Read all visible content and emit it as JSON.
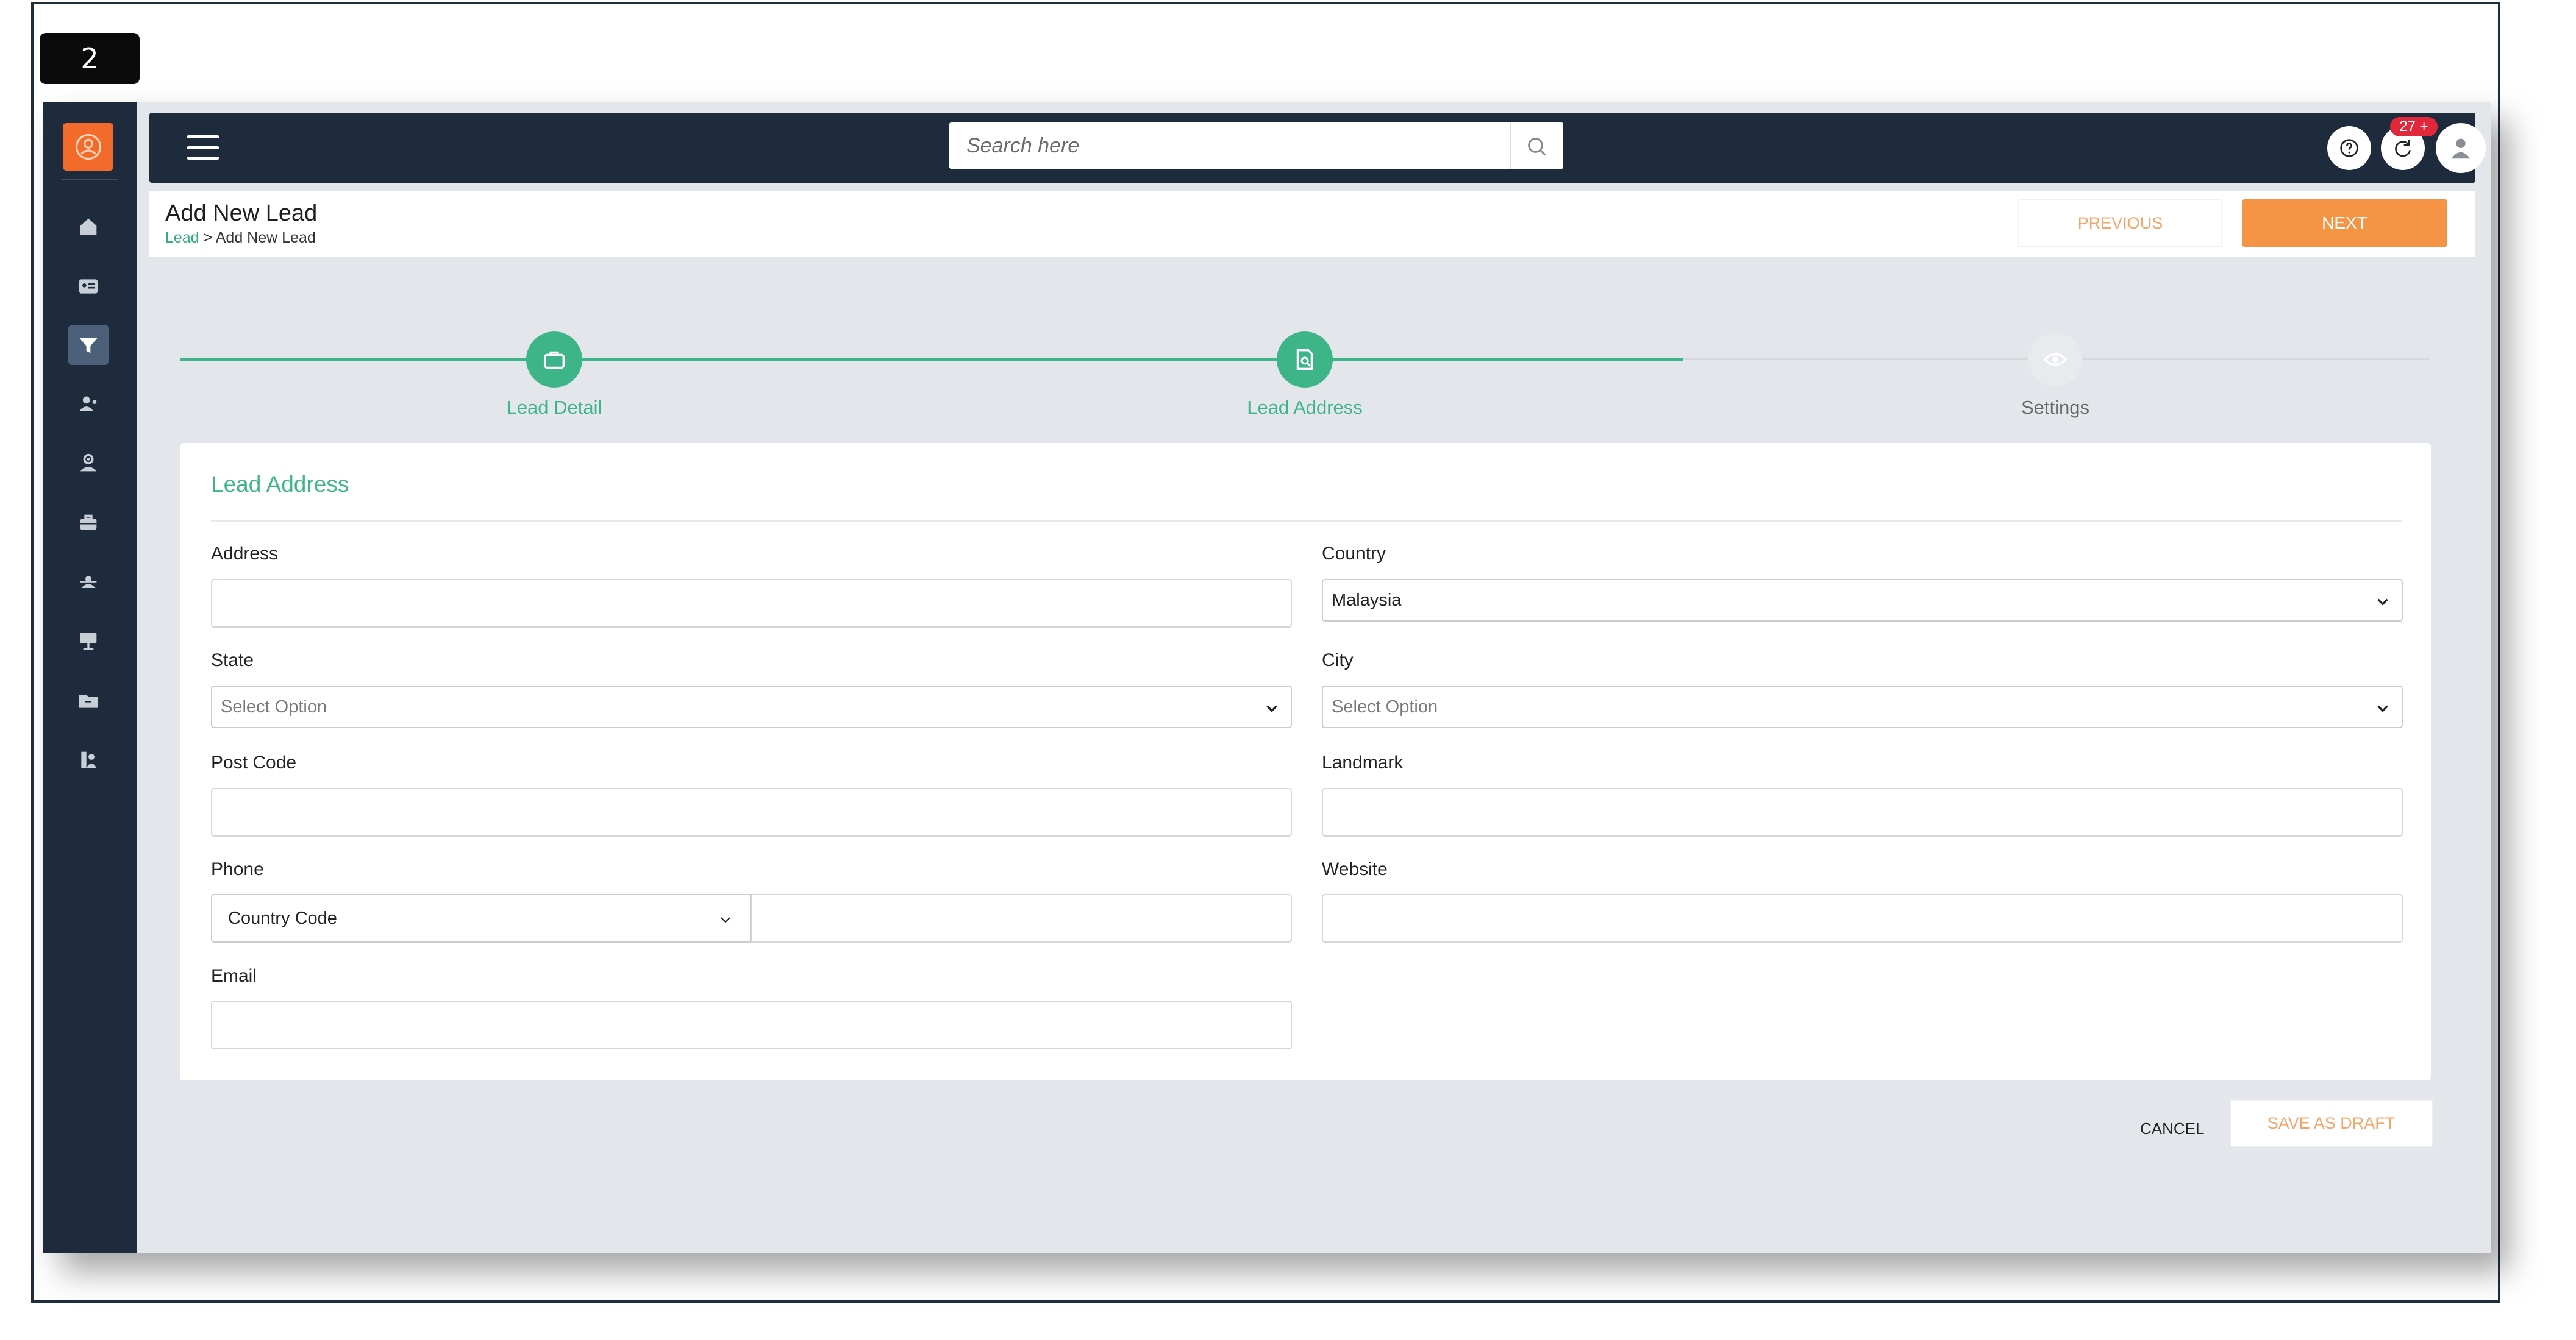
{
  "step_badge": "2",
  "header": {
    "search_placeholder": "Search here",
    "notification_count": "27 +"
  },
  "page": {
    "title": "Add New Lead",
    "breadcrumb_link": "Lead",
    "breadcrumb_separator": " > ",
    "breadcrumb_current": "Add New Lead",
    "previous_label": "PREVIOUS",
    "next_label": "NEXT"
  },
  "stepper": {
    "steps": [
      {
        "label": "Lead Detail",
        "state": "done",
        "icon": "briefcase-icon"
      },
      {
        "label": "Lead Address",
        "state": "current",
        "icon": "document-search-icon"
      },
      {
        "label": "Settings",
        "state": "todo",
        "icon": "eye-icon"
      }
    ]
  },
  "form": {
    "section_title": "Lead Address",
    "address_label": "Address",
    "address_value": "",
    "country_label": "Country",
    "country_value": "Malaysia",
    "state_label": "State",
    "state_value": "Select Option",
    "city_label": "City",
    "city_value": "Select Option",
    "postcode_label": "Post Code",
    "postcode_value": "",
    "landmark_label": "Landmark",
    "landmark_value": "",
    "phone_label": "Phone",
    "country_code_value": "Country Code",
    "phone_value": "",
    "website_label": "Website",
    "website_value": "",
    "email_label": "Email",
    "email_value": ""
  },
  "footer": {
    "cancel_label": "CANCEL",
    "save_draft_label": "SAVE AS DRAFT"
  },
  "sidebar": {
    "items": [
      {
        "icon": "home-icon"
      },
      {
        "icon": "id-card-icon"
      },
      {
        "icon": "funnel-icon",
        "active": true
      },
      {
        "icon": "user-group-icon"
      },
      {
        "icon": "user-settings-icon"
      },
      {
        "icon": "briefcase-icon"
      },
      {
        "icon": "users-icon"
      },
      {
        "icon": "presentation-icon"
      },
      {
        "icon": "folder-icon"
      },
      {
        "icon": "contacts-icon"
      }
    ]
  },
  "colors": {
    "sidebar": "#1e2b3c",
    "accent_green": "#3db588",
    "accent_orange": "#f59444",
    "logo_orange": "#f26b2a",
    "badge_red": "#e0283a"
  }
}
